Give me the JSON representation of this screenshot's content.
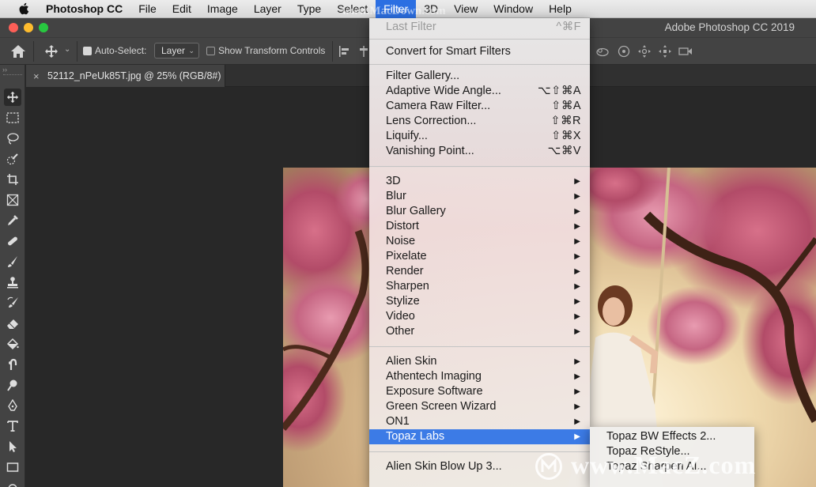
{
  "menubar": {
    "app_name": "Photoshop CC",
    "items": [
      "File",
      "Edit",
      "Image",
      "Layer",
      "Type",
      "Select",
      "Filter",
      "3D",
      "View",
      "Window",
      "Help"
    ],
    "active_index": 6,
    "watermark": "www.MacDown.com"
  },
  "window": {
    "title": "Adobe Photoshop CC 2019",
    "traffic_lights": {
      "close": "#fd5f57",
      "minimize": "#febc2e",
      "zoom": "#28c840"
    }
  },
  "options_bar": {
    "auto_select_label": "Auto-Select:",
    "auto_select_checked": true,
    "auto_select_target": "Layer",
    "show_transform_label": "Show Transform Controls",
    "show_transform_checked": false
  },
  "document_tab": {
    "close_glyph": "×",
    "name": "52112_nPeUk85T.jpg @ 25% (RGB/8#)"
  },
  "filter_menu": {
    "items": [
      {
        "label": "Last Filter",
        "shortcut": "^⌘F",
        "disabled": true
      },
      {
        "label": "Convert for Smart Filters"
      },
      {
        "label": "Filter Gallery..."
      },
      {
        "label": "Adaptive Wide Angle...",
        "shortcut": "⌥⇧⌘A"
      },
      {
        "label": "Camera Raw Filter...",
        "shortcut": "⇧⌘A"
      },
      {
        "label": "Lens Correction...",
        "shortcut": "⇧⌘R"
      },
      {
        "label": "Liquify...",
        "shortcut": "⇧⌘X"
      },
      {
        "label": "Vanishing Point...",
        "shortcut": "⌥⌘V"
      },
      {
        "label": "3D",
        "submenu": true
      },
      {
        "label": "Blur",
        "submenu": true
      },
      {
        "label": "Blur Gallery",
        "submenu": true
      },
      {
        "label": "Distort",
        "submenu": true
      },
      {
        "label": "Noise",
        "submenu": true
      },
      {
        "label": "Pixelate",
        "submenu": true
      },
      {
        "label": "Render",
        "submenu": true
      },
      {
        "label": "Sharpen",
        "submenu": true
      },
      {
        "label": "Stylize",
        "submenu": true
      },
      {
        "label": "Video",
        "submenu": true
      },
      {
        "label": "Other",
        "submenu": true
      },
      {
        "label": "Alien Skin",
        "submenu": true
      },
      {
        "label": "Athentech Imaging",
        "submenu": true
      },
      {
        "label": "Exposure Software",
        "submenu": true
      },
      {
        "label": "Green Screen Wizard",
        "submenu": true
      },
      {
        "label": "ON1",
        "submenu": true
      },
      {
        "label": "Topaz Labs",
        "submenu": true,
        "highlighted": true
      },
      {
        "label": "Alien Skin Blow Up 3..."
      }
    ],
    "arrow_glyph": "▶"
  },
  "topaz_submenu": {
    "items": [
      "Topaz BW Effects 2...",
      "Topaz ReStyle...",
      "Topaz Sharpen AI..."
    ]
  },
  "watermark_bottom": "www.MacZ.com",
  "colors": {
    "menu_highlight": "#3c7be6",
    "panel_bg": "#434343",
    "canvas_bg": "#282828"
  }
}
